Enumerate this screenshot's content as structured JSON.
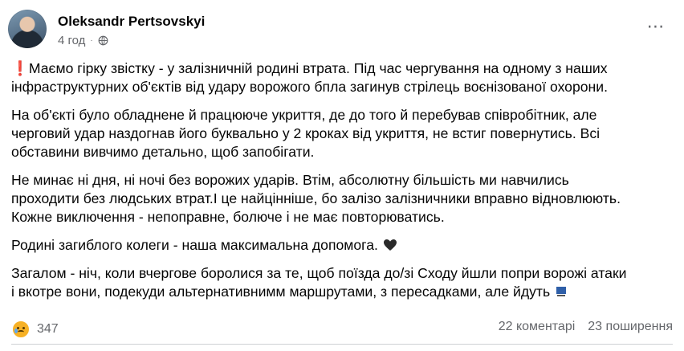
{
  "post": {
    "author": "Oleksandr Pertsovskyi",
    "time": "4 год",
    "separator": "·",
    "paragraphs": [
      "Маємо гірку звістку - у залізничній родині втрата. Під час чергування на одному з наших\nінфраструктурних об'єктів від удару ворожого бпла загинув стрілець воєнізованої охорони.",
      "На об'єкті було обладнене й працююче укриття, де до того й перебував співробітник, але\nчерговий удар наздогнав його буквально у 2 кроках від укриття, не встиг повернутись. Всі\nобставини вивчимо детально, щоб запобігати.",
      "Не минає ні дня, ні ночі без ворожих ударів. Втім, абсолютну більшість ми навчились\nпроходити без людських втрат.І це найцінніше, бо залізо залізничники вправно відновлюють.\nКожне виключення - непоправне, болюче і не має повторюватись.",
      "Родині загиблого колеги - наша максимальна допомога.",
      "Загалом - ніч, коли вчергове боролися за те, щоб поїзда до/зі Сходу йшли попри ворожі атаки\nі вкотре вони, подекуди альтернативнимм маршрутами, з пересадками, але йдуть"
    ],
    "reactions_count": "347",
    "comments": "22 коментарі",
    "shares": "23 поширення",
    "more_icon": "⋯"
  },
  "icons": {
    "exclamation": "red-exclamation-icon",
    "heart": "black-heart-icon",
    "train": "train-icon",
    "reaction": "sad-face-icon",
    "globe": "globe-icon"
  },
  "colors": {
    "secondary_text": "#65676b",
    "exclamation": "#e0312b",
    "reaction": "#f7b125"
  }
}
